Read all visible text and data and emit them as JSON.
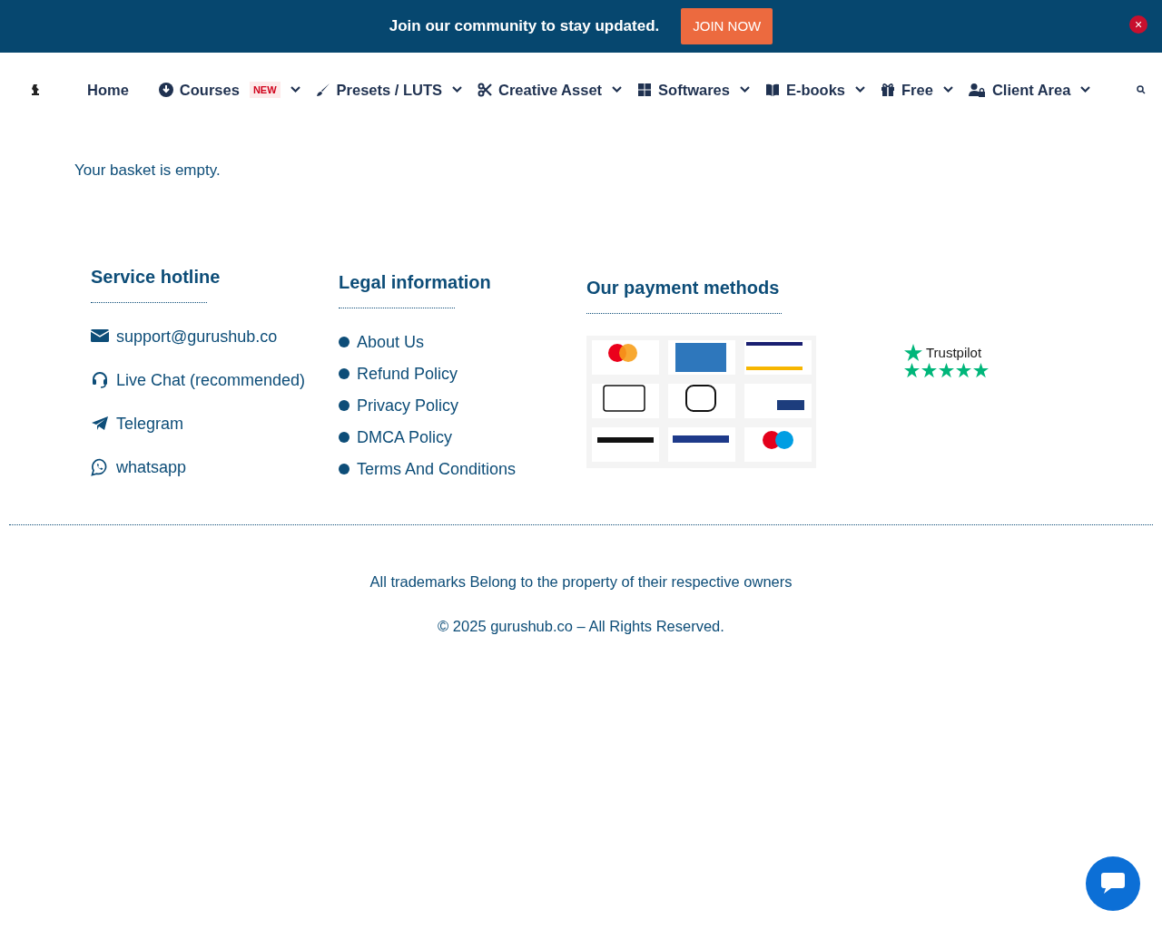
{
  "announcement": {
    "text": "Join our community to stay updated.",
    "button": "JOIN NOW",
    "close": "×"
  },
  "nav": {
    "items": [
      {
        "label": "Home",
        "dropdown": false
      },
      {
        "label": "Courses",
        "dropdown": true,
        "badge": "NEW"
      },
      {
        "label": "Presets / LUTS",
        "dropdown": true
      },
      {
        "label": "Creative Asset",
        "dropdown": true
      },
      {
        "label": "Softwares",
        "dropdown": true
      },
      {
        "label": "E-books",
        "dropdown": true
      },
      {
        "label": "Free",
        "dropdown": true
      },
      {
        "label": "Client Area",
        "dropdown": true
      }
    ]
  },
  "message": "Your basket is empty.",
  "footer": {
    "service": {
      "title": "Service hotline",
      "items": [
        {
          "label": "support@gurushub.co"
        },
        {
          "label": "Live Chat (recommended)"
        },
        {
          "label": "Telegram"
        },
        {
          "label": "whatsapp"
        }
      ]
    },
    "legal": {
      "title": "Legal information",
      "items": [
        "About Us",
        "Refund Policy",
        "Privacy Policy",
        "DMCA Policy",
        "Terms And Conditions"
      ]
    },
    "payment": {
      "title": "Our payment methods"
    },
    "trustpilot": {
      "label": "Trustpilot",
      "stars": 5
    },
    "trademark": "All trademarks Belong to the property of their respective owners",
    "copyright": "© 2025 gurushub.co – All Rights Reserved."
  }
}
